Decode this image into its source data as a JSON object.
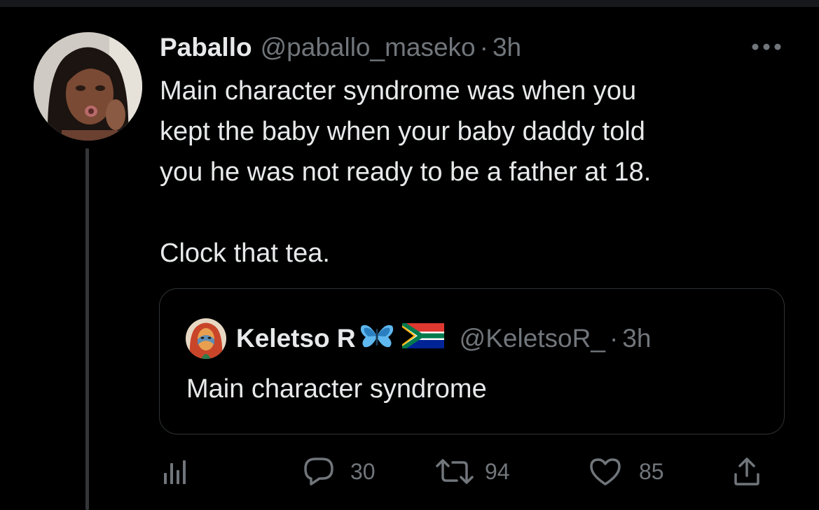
{
  "tweet": {
    "author_name": "Paballo",
    "author_handle": "@paballo_maseko",
    "separator": "·",
    "time": "3h",
    "text": "Main character syndrome was when you\nkept the baby when your baby daddy told\nyou he was not ready to be a father at 18.",
    "text_2": "Clock that tea."
  },
  "quote": {
    "author_name": "Keletso R",
    "emojis": [
      "butterfly-emoji",
      "south-africa-flag-emoji"
    ],
    "author_handle": "@KeletsoR_",
    "separator": "·",
    "time": "3h",
    "text": "Main character syndrome"
  },
  "actions": {
    "replies": "30",
    "retweets": "94",
    "likes": "85"
  },
  "icons": [
    "more-icon",
    "analytics-icon",
    "reply-icon",
    "retweet-icon",
    "like-icon",
    "share-icon"
  ],
  "colors": {
    "background": "#000000",
    "text_primary": "#e7e9ea",
    "text_secondary": "#71767b",
    "border": "#2f3336"
  }
}
